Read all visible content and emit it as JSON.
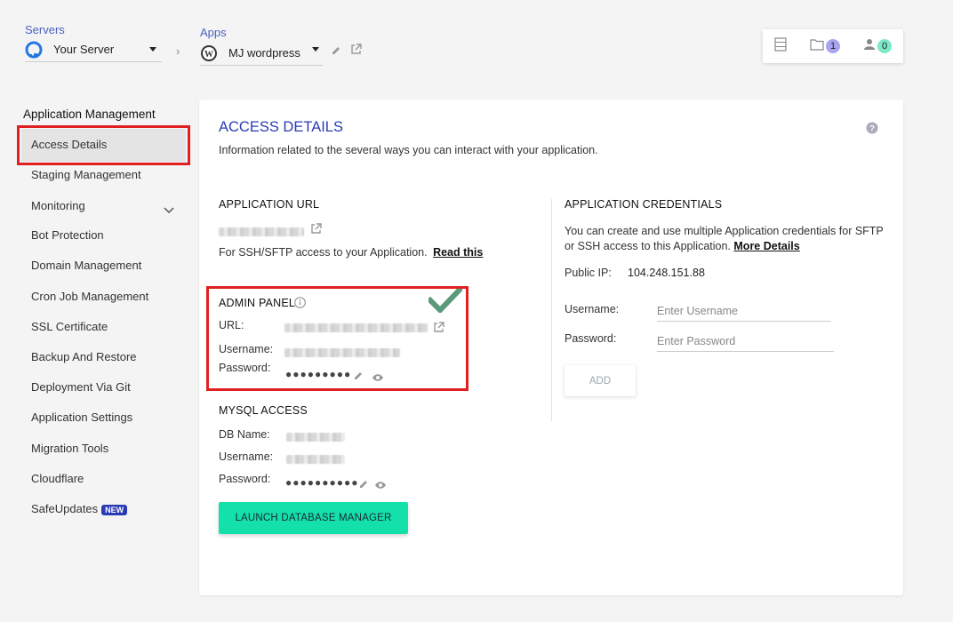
{
  "top": {
    "servers_label": "Servers",
    "server_name": "Your Server",
    "apps_label": "Apps",
    "app_name": "MJ wordpress",
    "widget_files_count": "1",
    "widget_users_count": "0"
  },
  "sidebar": {
    "heading": "Application Management",
    "items": [
      {
        "label": "Access Details"
      },
      {
        "label": "Staging Management"
      },
      {
        "label": "Monitoring"
      },
      {
        "label": "Bot Protection"
      },
      {
        "label": "Domain Management"
      },
      {
        "label": "Cron Job Management"
      },
      {
        "label": "SSL Certificate"
      },
      {
        "label": "Backup And Restore"
      },
      {
        "label": "Deployment Via Git"
      },
      {
        "label": "Application Settings"
      },
      {
        "label": "Migration Tools"
      },
      {
        "label": "Cloudflare"
      },
      {
        "label": "SafeUpdates"
      }
    ],
    "new_badge": "NEW"
  },
  "card": {
    "title": "ACCESS DETAILS",
    "subtitle": "Information related to the several ways you can interact with your application.",
    "app_url": {
      "title": "APPLICATION URL",
      "ssh_text": "For SSH/SFTP access to your Application.",
      "read_link": "Read this"
    },
    "admin_panel": {
      "title": "ADMIN PANEL",
      "url_label": "URL:",
      "username_label": "Username:",
      "password_label": "Password:",
      "password_mask": "●●●●●●●●●"
    },
    "mysql": {
      "title": "MYSQL ACCESS",
      "db_label": "DB Name:",
      "username_label": "Username:",
      "password_label": "Password:",
      "password_mask": "●●●●●●●●●●",
      "launch_button": "LAUNCH DATABASE MANAGER"
    },
    "credentials": {
      "title": "APPLICATION CREDENTIALS",
      "text_before": "You can create and use multiple Application credentials for SFTP or SSH access to this Application.",
      "more_link": "More Details",
      "public_ip_label": "Public IP:",
      "public_ip": "104.248.151.88",
      "username_label": "Username:",
      "username_placeholder": "Enter Username",
      "password_label": "Password:",
      "password_placeholder": "Enter Password",
      "add_button": "ADD"
    }
  },
  "colors": {
    "accent": "#2a3bb5",
    "highlight": "#e02020",
    "launch": "#14e0a9",
    "check": "#5a9a7a"
  }
}
